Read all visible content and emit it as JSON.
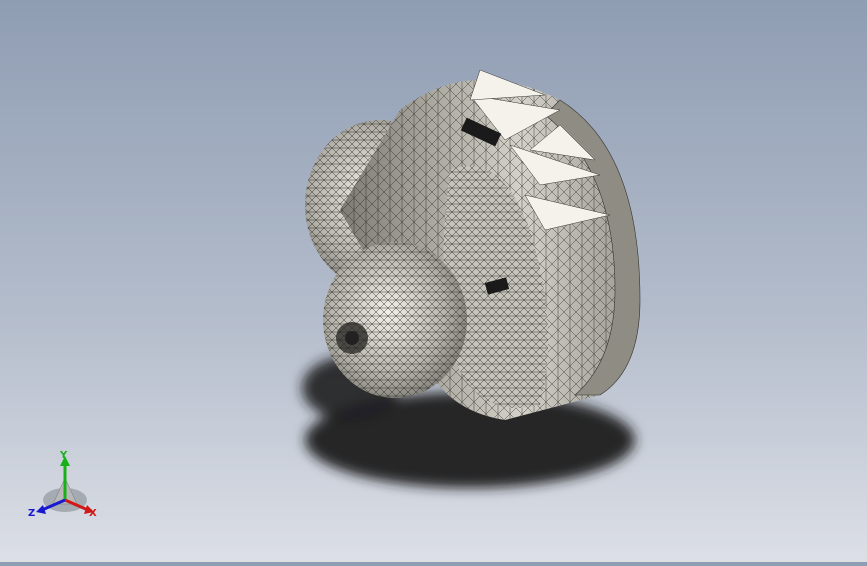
{
  "triad": {
    "x_label": "X",
    "y_label": "Y",
    "z_label": "Z"
  },
  "colors": {
    "background_top": "#8f9db3",
    "background_bottom": "#dcdfe6",
    "mesh_fill": "#c9c7bd",
    "mesh_line": "#1e1e1e",
    "axis_x": "#d01818",
    "axis_y": "#18b018",
    "axis_z": "#1818d0"
  },
  "icons": {
    "model": "mesh-model-icon",
    "triad": "reference-triad-icon"
  }
}
